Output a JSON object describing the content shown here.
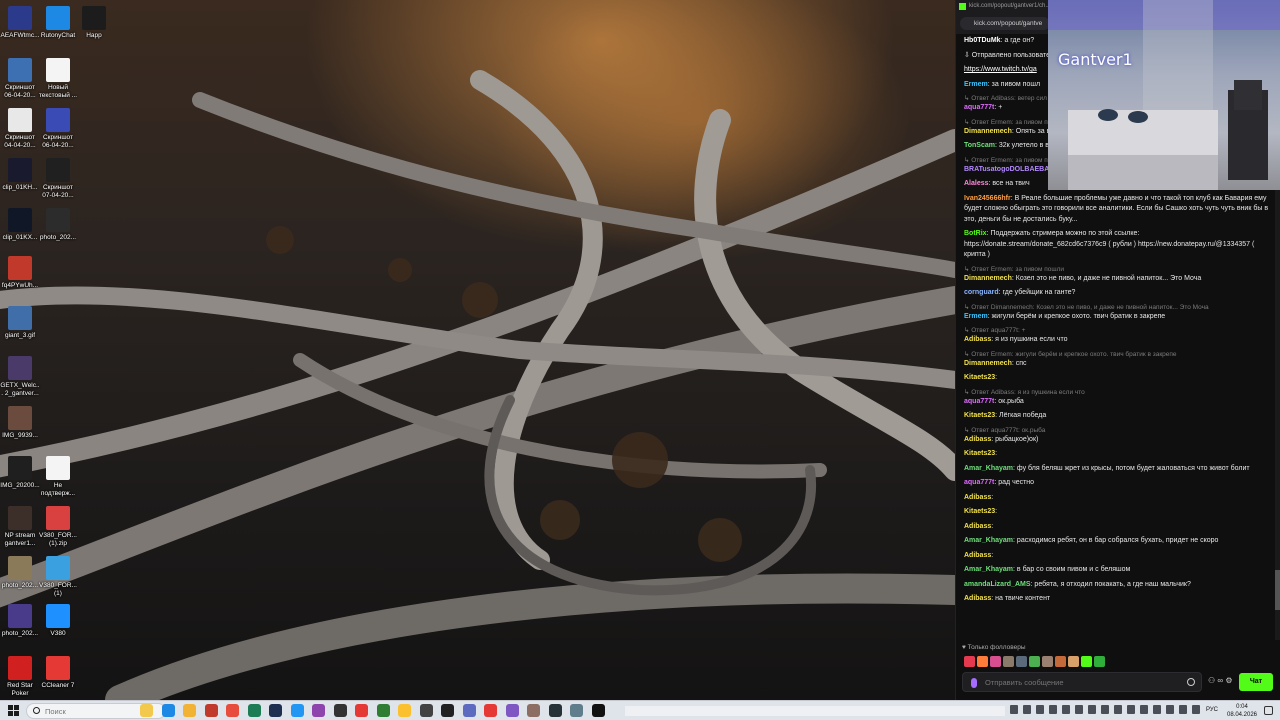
{
  "desktop": {
    "icons": [
      {
        "label": "AEAFWtmc...",
        "color": "#2b3a8a"
      },
      {
        "label": "RutonyChat",
        "color": "#1e88e5"
      },
      {
        "label": "Happ",
        "color": "#1c1c1c"
      },
      {
        "label": "Скриншот 06-04-20...",
        "color": "#3d6fb3"
      },
      {
        "label": "Новый текстовый ...",
        "color": "#f4f4f4"
      },
      {
        "label": "Скриншот 04-04-20...",
        "color": "#e8e8e8"
      },
      {
        "label": "Скриншот 06-04-20...",
        "color": "#3a4bb5"
      },
      {
        "label": "clip_01KH...",
        "color": "#1a1a2e"
      },
      {
        "label": "Скриншот 07-04-20...",
        "color": "#202020"
      },
      {
        "label": "clip_01KX...",
        "color": "#101828"
      },
      {
        "label": "photo_202...",
        "color": "#2c2c2c"
      },
      {
        "label": "fq4PYwUh...",
        "color": "#c0392b"
      },
      {
        "label": "giant_3.gif",
        "color": "#3f6ea8"
      },
      {
        "label": "GETX_Welc... 2_gantver...",
        "color": "#4a3a6a"
      },
      {
        "label": "IMG_9939...",
        "color": "#6b4b3e"
      },
      {
        "label": "IMG_20200...",
        "color": "#1f1f1f"
      },
      {
        "label": "Не подтверж...",
        "color": "#f4f4f4"
      },
      {
        "label": "NP stream gantver1...",
        "color": "#3c2f2a"
      },
      {
        "label": "V380_FOR... (1).zip",
        "color": "#d94040"
      },
      {
        "label": "photo_202...",
        "color": "#8a7a5a"
      },
      {
        "label": "V380_FOR... (1)",
        "color": "#3aa0e0"
      },
      {
        "label": "photo_202...",
        "color": "#4a3a8a"
      },
      {
        "label": "V380",
        "color": "#1e90ff"
      },
      {
        "label": "Red Star Poker",
        "color": "#d02020"
      },
      {
        "label": "CCleaner 7",
        "color": "#e53935"
      }
    ]
  },
  "browser": {
    "title": "kick.com/popout/gantver1/ch...",
    "url": "kick.com/popout/gantve"
  },
  "webcam": {
    "overlay_name": "Gantver1"
  },
  "chat": {
    "messages": [
      {
        "reply": "",
        "user": "Hb0TDuMk",
        "user_color": "#ffffff",
        "text": ": а где он?"
      },
      {
        "reply": "",
        "user": "",
        "user_color": "#ffffff",
        "text": "⇩ Отправлено пользовател..."
      },
      {
        "reply": "",
        "user": "",
        "user_color": "#ffffff",
        "text": "https://www.twitch.tv/ga",
        "link": true
      },
      {
        "reply": "",
        "user": "Ermem",
        "user_color": "#35c4ff",
        "text": ": за пивом пошл"
      },
      {
        "reply": "↳ Ответ Adibass: ветер сил",
        "user": "aqua777t",
        "user_color": "#e06cff",
        "text": ": +"
      },
      {
        "reply": "↳ Ответ Ermem: за пивом по",
        "user": "Dimannemech",
        "user_color": "#f2e24b",
        "text": ": Опять за в"
      },
      {
        "reply": "",
        "user": "TonScam",
        "user_color": "#6fe07a",
        "text": ": 32к улетело в в"
      },
      {
        "reply": "↳ Ответ Ermem: за пивом по",
        "user": "BRATusatogoDOLBAEBA",
        "user_color": "#b388ff",
        "text": ":"
      },
      {
        "reply": "",
        "user": "Alaless",
        "user_color": "#ff8ad8",
        "text": ": все на твич"
      },
      {
        "reply": "",
        "user": "Ivan245666hfr",
        "user_color": "#ff9f43",
        "text": ": В Реале большие проблемы уже давно и что такой топ клуб как Бавария ему будет сложно обыграть это говорили все аналитики. Если бы Сашко хоть чуть чуть вник бы в это, деньги бы не достались буку..."
      },
      {
        "reply": "",
        "user": "BotRix",
        "user_color": "#53fc18",
        "text": ": Поддержать стримера можно по этой ссылке: https://donate.stream/donate_682cd6c7376c9 ( рубли ) https://new.donatepay.ru/@1334357 ( крипта )"
      },
      {
        "reply": "↳ Ответ Ermem: за пивом пошли",
        "user": "Dimannemech",
        "user_color": "#f2e24b",
        "text": ": Козел это не пиво, и даже не пивной напиток... Это Моча"
      },
      {
        "reply": "",
        "user": "cornguard",
        "user_color": "#8ab4ff",
        "text": ": где убейщик на ганте?"
      },
      {
        "reply": "↳ Ответ Dimannemech: Козел это не пиво, и даже не пивной напиток... Это Моча",
        "user": "Ermem",
        "user_color": "#35c4ff",
        "text": ": жигули берём и крепкое охото. твич братик в закрепе"
      },
      {
        "reply": "↳ Ответ aqua777t: +",
        "user": "Adibass",
        "user_color": "#f2e24b",
        "text": ": я из пушкина если что"
      },
      {
        "reply": "↳ Ответ Ermem: жигули берём и крепкое охото. твич братик в закрепе",
        "user": "Dimannemech",
        "user_color": "#f2e24b",
        "text": ": спс"
      },
      {
        "reply": "",
        "user": "Kitaets23",
        "user_color": "#f2e24b",
        "text": ":"
      },
      {
        "reply": "↳ Ответ Adibass: я из пушкина если что",
        "user": "aqua777t",
        "user_color": "#e06cff",
        "text": ": ок.рыба"
      },
      {
        "reply": "",
        "user": "Kitaets23",
        "user_color": "#f2e24b",
        "text": ": Лёгкая победа"
      },
      {
        "reply": "↳ Ответ aqua777t: ок.рыба",
        "user": "Adibass",
        "user_color": "#f2e24b",
        "text": ": рыбацкое)ок)"
      },
      {
        "reply": "",
        "user": "Kitaets23",
        "user_color": "#f2e24b",
        "text": ":"
      },
      {
        "reply": "",
        "user": "Amar_Khayam",
        "user_color": "#6fe07a",
        "text": ": фу бля беляш жрет из крысы, потом будет жаловаться что живот болит"
      },
      {
        "reply": "",
        "user": "aqua777t",
        "user_color": "#e06cff",
        "text": ": рад честно"
      },
      {
        "reply": "",
        "user": "Adibass",
        "user_color": "#f2e24b",
        "text": ":"
      },
      {
        "reply": "",
        "user": "Kitaets23",
        "user_color": "#f2e24b",
        "text": ":"
      },
      {
        "reply": "",
        "user": "Adibass",
        "user_color": "#f2e24b",
        "text": ":"
      },
      {
        "reply": "",
        "user": "Amar_Khayam",
        "user_color": "#6fe07a",
        "text": ": расходимся ребят, он в бар собрался бухать, придет не скоро"
      },
      {
        "reply": "",
        "user": "Adibass",
        "user_color": "#f2e24b",
        "text": ":"
      },
      {
        "reply": "",
        "user": "Amar_Khayam",
        "user_color": "#6fe07a",
        "text": ": в бар со своим пивом и с беляшом"
      },
      {
        "reply": "",
        "user": "amandaLizard_AMS",
        "user_color": "#6fe07a",
        "text": ": ребята, я отходил покакать, а где наш мальчик?"
      },
      {
        "reply": "",
        "user": "Adibass",
        "user_color": "#f2e24b",
        "text": ": на твиче контент"
      }
    ],
    "followers_only": "♥ Только фолловеры",
    "input_placeholder": "Отправить сообщение",
    "send_label": "Чат",
    "tools_glyph": "⚇ ∞ ⚙"
  },
  "taskbar": {
    "search_placeholder": "Поиск",
    "language": "РУС",
    "time": "0:04",
    "date": "08.04.2026",
    "apps": [
      {
        "name": "copilot-icon",
        "color": "#f2c94c"
      },
      {
        "name": "edge-icon",
        "color": "#1e88e5"
      },
      {
        "name": "explorer-icon",
        "color": "#f2b233"
      },
      {
        "name": "app-icon",
        "color": "#c0392b"
      },
      {
        "name": "app-64-icon",
        "color": "#e74c3c"
      },
      {
        "name": "app-icon",
        "color": "#1c7c54"
      },
      {
        "name": "app-icon",
        "color": "#1f2f4f"
      },
      {
        "name": "edge-icon",
        "color": "#2196f3"
      },
      {
        "name": "app-icon",
        "color": "#8e44ad"
      },
      {
        "name": "obs-icon",
        "color": "#333333"
      },
      {
        "name": "chrome-icon",
        "color": "#e53935"
      },
      {
        "name": "app-icon",
        "color": "#2e7d32"
      },
      {
        "name": "app-icon",
        "color": "#fbc02d"
      },
      {
        "name": "app-icon",
        "color": "#424242"
      },
      {
        "name": "app-v2-icon",
        "color": "#212121"
      },
      {
        "name": "app-icon",
        "color": "#5c6bc0"
      },
      {
        "name": "yandex-icon",
        "color": "#e53935"
      },
      {
        "name": "app-icon",
        "color": "#7e57c2"
      },
      {
        "name": "app-icon",
        "color": "#8d6e63"
      },
      {
        "name": "app-icon",
        "color": "#263238"
      },
      {
        "name": "app-icon",
        "color": "#607d8b"
      },
      {
        "name": "happ-icon",
        "color": "#111111"
      }
    ]
  },
  "colors": {
    "kick_green": "#53fc18",
    "chat_bg": "#0f0f10",
    "taskbar_bg": "#dfe3ea"
  }
}
